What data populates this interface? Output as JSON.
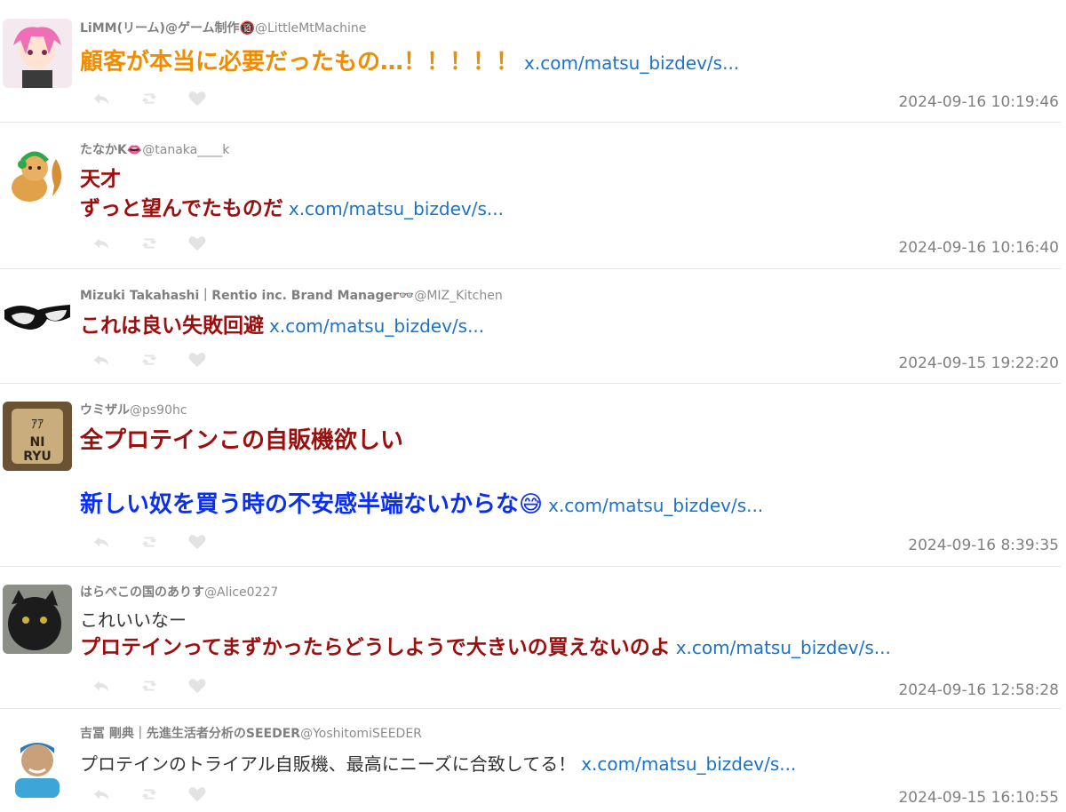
{
  "colors": {
    "orange": "#f08c00",
    "darkred": "#9b0f0f",
    "blue": "#0b2ff0",
    "link": "#1a73c8"
  },
  "tweets": [
    {
      "name": "LiMM(リーム)@ゲーム制作🔞",
      "handle": "@LittleMtMachine",
      "lines": [
        "顧客が本当に必要だったもの…！！！！！"
      ],
      "link": "x.com/matsu_bizdev/s...",
      "time": "2024-09-16 10:19:46"
    },
    {
      "name": "たなかK👄",
      "handle": "@tanaka____k",
      "lines": [
        "天才",
        "ずっと望んでたものだ"
      ],
      "link": "x.com/matsu_bizdev/s...",
      "time": "2024-09-16 10:16:40"
    },
    {
      "name": "Mizuki Takahashi｜Rentio inc. Brand Manager👓",
      "handle": "@MIZ_Kitchen",
      "lines": [
        "これは良い失敗回避"
      ],
      "link": "x.com/matsu_bizdev/s...",
      "time": "2024-09-15 19:22:20"
    },
    {
      "name": "ウミザル",
      "handle": "@ps90hc",
      "lines": [
        "全プロテインこの自販機欲しい",
        "新しい奴を買う時の不安感半端ないからな😅"
      ],
      "link": "x.com/matsu_bizdev/s...",
      "time": "2024-09-16 8:39:35"
    },
    {
      "name": "はらぺこの国のありす",
      "handle": "@Alice0227",
      "lines": [
        "これいいなー",
        "プロテインってまずかったらどうしようで大きいの買えないのよ"
      ],
      "link": "x.com/matsu_bizdev/s...",
      "time": "2024-09-16 12:58:28"
    },
    {
      "name": "吉冨 剛典｜先進生活者分析のSEEDER",
      "handle": "@YoshitomiSEEDER",
      "lines": [
        "プロテインのトライアル自販機、最高にニーズに合致してる！"
      ],
      "link": "x.com/matsu_bizdev/s...",
      "time": "2024-09-15 16:10:55"
    }
  ],
  "icons": [
    "reply-icon",
    "retweet-icon",
    "like-icon"
  ]
}
